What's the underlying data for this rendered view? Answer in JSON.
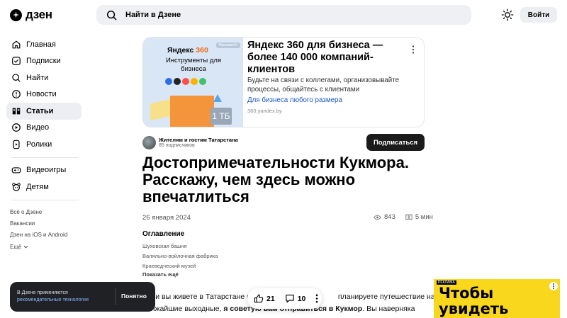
{
  "header": {
    "logo_text": "дзен",
    "search_placeholder": "Найти в Дзене",
    "login_label": "Войти"
  },
  "sidebar": {
    "items": [
      {
        "label": "Главная",
        "icon": "home-icon"
      },
      {
        "label": "Подписки",
        "icon": "subscriptions-icon"
      },
      {
        "label": "Найти",
        "icon": "search-icon"
      },
      {
        "label": "Новости",
        "icon": "news-icon"
      },
      {
        "label": "Статьи",
        "icon": "articles-icon",
        "active": true
      },
      {
        "label": "Видео",
        "icon": "video-icon"
      },
      {
        "label": "Ролики",
        "icon": "shorts-icon"
      }
    ],
    "items2": [
      {
        "label": "Видеоигры",
        "icon": "gamepad-icon"
      },
      {
        "label": "Детям",
        "icon": "kids-icon"
      }
    ],
    "links": [
      "Всё о Дзене",
      "Вакансии",
      "Дзен на iOS и Android"
    ],
    "more_label": "Ещё"
  },
  "ad": {
    "image_brand": "Яндекс",
    "image_brand_num": "360",
    "image_badge": "Реклама•0+",
    "image_subtitle": "Инструменты для бизнеса",
    "image_tb": "1 ТБ",
    "title": "Яндекс 360 для бизнеса — более 140 000 компаний-клиентов",
    "description": "Будьте на связи с коллегами, организовывайте процессы, общайтесь с клиентами",
    "link": "Для бизнеса любого размера",
    "domain": "360.yandex.by"
  },
  "channel": {
    "name": "Жителям и гостям Татарстана",
    "subscribers": "85 подписчиков",
    "subscribe_label": "Подписаться"
  },
  "article": {
    "title": "Достопримечательности Кукмора. Расскажу, чем здесь можно впечатлиться",
    "date": "26 января 2024",
    "views": "843",
    "read_time": "5 мин",
    "toc_title": "Оглавление",
    "toc": [
      "Шуховская башня",
      "Валяльно-войлочная фабрика",
      "Краеведческий музей"
    ],
    "toc_more": "Показать ещё",
    "body_line1_a": "Если вы живете в Татарстане и ",
    "body_line1_b": "планируете путешествие на",
    "body_line2_a": "ближайшие выходные, ",
    "body_line2_b": "я советую вам отправиться в Кукмор",
    "body_line2_c": ". Вы наверняка"
  },
  "reactions": {
    "likes": "21",
    "comments": "10"
  },
  "cookie": {
    "text": "В Дзене применяются",
    "link": "рекомендательные технологии",
    "button": "Понятно"
  },
  "side_ad": {
    "label": "РЕКЛАМА",
    "text": "Чтобы увидеть"
  },
  "colors": {
    "accent_link": "#1c59c8",
    "side_ad_bg": "#f9d71c",
    "subscribe_bg": "#1b1b1b"
  }
}
